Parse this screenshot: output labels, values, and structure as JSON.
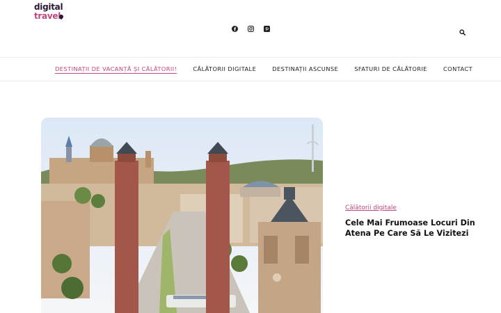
{
  "site": {
    "logo_line1": "digital",
    "logo_line2": "travel"
  },
  "header": {
    "icons": [
      "facebook-icon",
      "instagram-icon",
      "pinterest-icon",
      "search-icon"
    ]
  },
  "nav": {
    "items": [
      {
        "label": "Destinații de vacanță și călătorii!",
        "active": true
      },
      {
        "label": "Călătorii digitale",
        "active": false
      },
      {
        "label": "Destinații ascunse",
        "active": false
      },
      {
        "label": "Sfaturi de călătorie",
        "active": false
      },
      {
        "label": "Contact",
        "active": false
      }
    ]
  },
  "featured": {
    "image": "barcelona-placa-espanya-photo",
    "category": "Călătorii digitale",
    "title": "Cele Mai Frumoase Locuri Din Atena Pe Care Să Le Vizitezi"
  },
  "colors": {
    "accent": "#c0457e",
    "text": "#111111",
    "border": "#ececec"
  }
}
